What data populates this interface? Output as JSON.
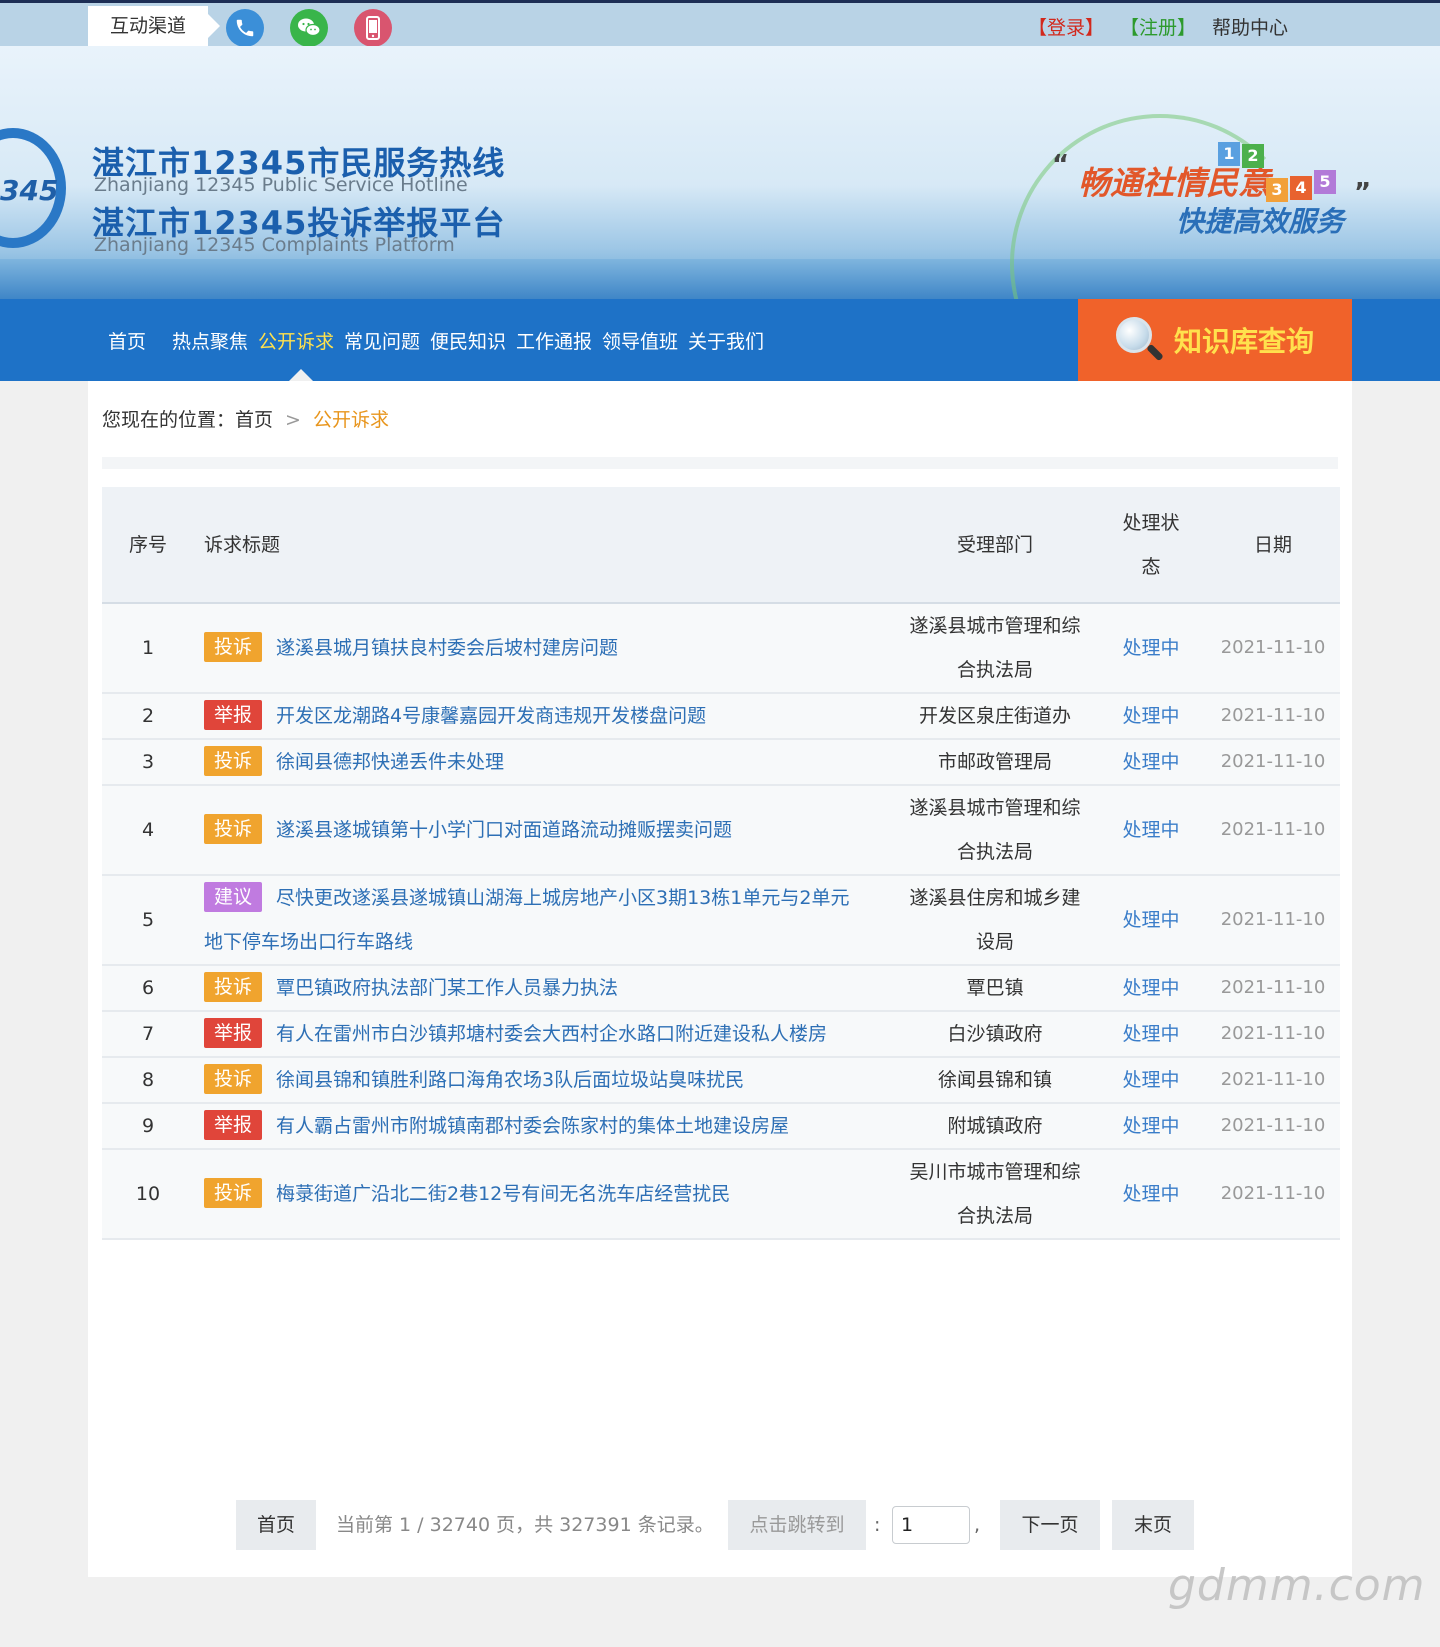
{
  "topbar": {
    "channel_label": "互动渠道",
    "icons": [
      "phone-icon",
      "wechat-icon",
      "mobile-icon"
    ],
    "login": "【登录】",
    "register": "【注册】",
    "help": "帮助中心"
  },
  "banner": {
    "logo_text": "345",
    "title1": "湛江市12345市民服务热线",
    "subtitle1": "Zhanjiang 12345 Public Service Hotline",
    "title2": "湛江市12345投诉举报平台",
    "subtitle2": "Zhanjiang 12345 Complaints Platform",
    "slogan1": "畅通社情民意",
    "slogan2": "快捷高效服务",
    "quote_left": "“",
    "quote_right": "”",
    "number_blocks": [
      "1",
      "2",
      "3",
      "4",
      "5"
    ]
  },
  "nav": {
    "items": [
      "首页",
      "热点聚焦",
      "公开诉求",
      "常见问题",
      "便民知识",
      "工作通报",
      "领导值班",
      "关于我们"
    ],
    "active": "公开诉求",
    "knowledge_button": "知识库查询"
  },
  "breadcrumb": {
    "prefix": "您现在的位置：",
    "home": "首页",
    "separator": ">",
    "current": "公开诉求"
  },
  "table": {
    "headers": {
      "no": "序号",
      "title": "诉求标题",
      "dept": "受理部门",
      "status": "处理状态",
      "date": "日期"
    },
    "rows": [
      {
        "no": "1",
        "type": "投诉",
        "title": "遂溪县城月镇扶良村委会后坡村建房问题",
        "dept": "遂溪县城市管理和综合执法局",
        "status": "处理中",
        "date": "2021-11-10"
      },
      {
        "no": "2",
        "type": "举报",
        "title": "开发区龙潮路4号康馨嘉园开发商违规开发楼盘问题",
        "dept": "开发区泉庄街道办",
        "status": "处理中",
        "date": "2021-11-10"
      },
      {
        "no": "3",
        "type": "投诉",
        "title": "徐闻县德邦快递丢件未处理",
        "dept": "市邮政管理局",
        "status": "处理中",
        "date": "2021-11-10"
      },
      {
        "no": "4",
        "type": "投诉",
        "title": "遂溪县遂城镇第十小学门口对面道路流动摊贩摆卖问题",
        "dept": "遂溪县城市管理和综合执法局",
        "status": "处理中",
        "date": "2021-11-10"
      },
      {
        "no": "5",
        "type": "建议",
        "title": "尽快更改遂溪县遂城镇山湖海上城房地产小区3期13栋1单元与2单元地下停车场出口行车路线",
        "dept": "遂溪县住房和城乡建设局",
        "status": "处理中",
        "date": "2021-11-10"
      },
      {
        "no": "6",
        "type": "投诉",
        "title": "覃巴镇政府执法部门某工作人员暴力执法",
        "dept": "覃巴镇",
        "status": "处理中",
        "date": "2021-11-10"
      },
      {
        "no": "7",
        "type": "举报",
        "title": "有人在雷州市白沙镇邦塘村委会大西村企水路口附近建设私人楼房",
        "dept": "白沙镇政府",
        "status": "处理中",
        "date": "2021-11-10"
      },
      {
        "no": "8",
        "type": "投诉",
        "title": "徐闻县锦和镇胜利路口海角农场3队后面垃圾站臭味扰民",
        "dept": "徐闻县锦和镇",
        "status": "处理中",
        "date": "2021-11-10"
      },
      {
        "no": "9",
        "type": "举报",
        "title": "有人霸占雷州市附城镇南郡村委会陈家村的集体土地建设房屋",
        "dept": "附城镇政府",
        "status": "处理中",
        "date": "2021-11-10"
      },
      {
        "no": "10",
        "type": "投诉",
        "title": "梅菉街道广沿北二街2巷12号有间无名洗车店经营扰民",
        "dept": "吴川市城市管理和综合执法局",
        "status": "处理中",
        "date": "2021-11-10"
      }
    ]
  },
  "badge_colors": {
    "投诉": "#f0a42e",
    "举报": "#e0453a",
    "建议": "#c07be0"
  },
  "pager": {
    "first": "首页",
    "info": "当前第 1 / 32740 页，共 327391 条记录。",
    "jump_label": "点击跳转到",
    "colon": ":",
    "page_value": "1",
    "comma": ",",
    "next": "下一页",
    "last": "末页"
  },
  "watermark": "gdmm.com"
}
